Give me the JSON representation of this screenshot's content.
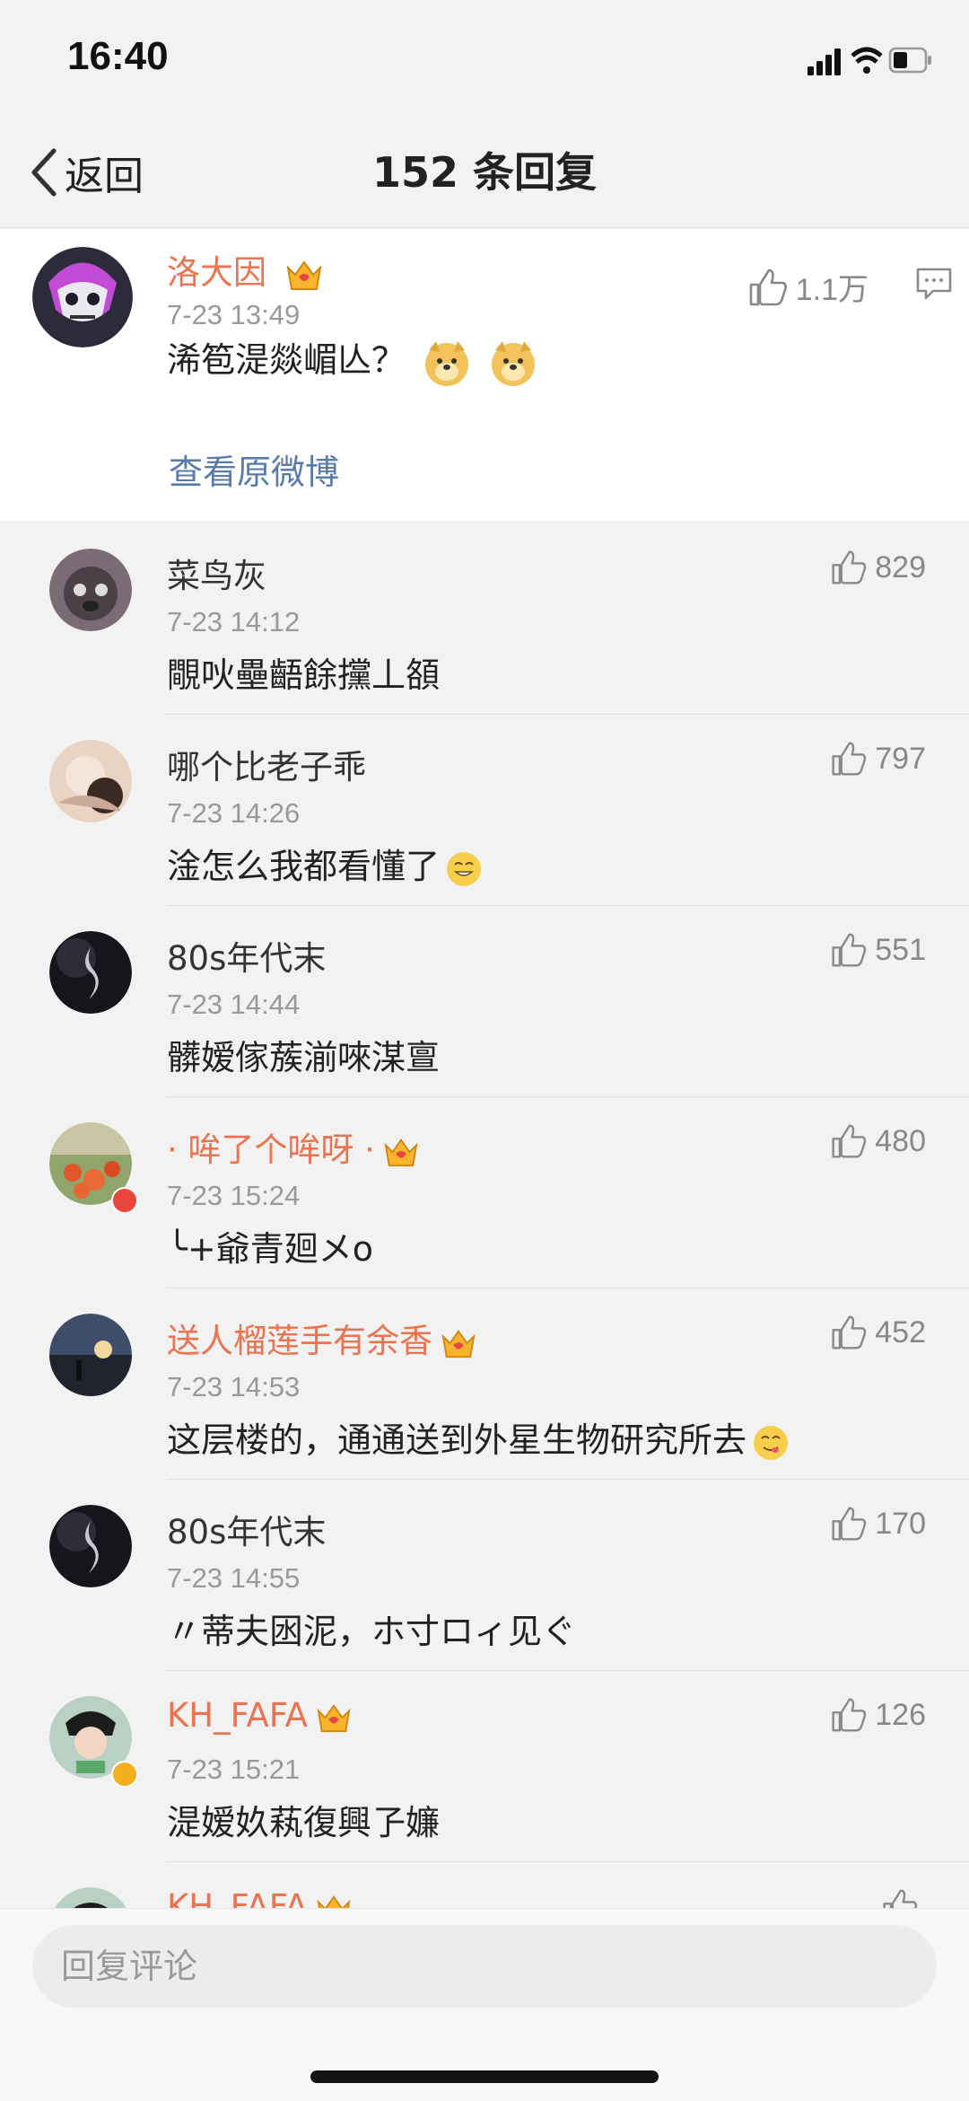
{
  "status_bar": {
    "time": "16:40"
  },
  "nav": {
    "back_label": "返回",
    "title": "152 条回复"
  },
  "main_comment": {
    "username": "洛大因",
    "timestamp": "7-23 13:49",
    "content": "浠笣湜燚嵋亾？",
    "likes": "1.1万",
    "view_original": "查看原微博"
  },
  "replies": [
    {
      "username": "菜鸟灰",
      "timestamp": "7-23 14:12",
      "content": "覸吙壘齬餘攩丄頟",
      "likes": "829"
    },
    {
      "username": "哪个比老子乖",
      "timestamp": "7-23 14:26",
      "content": "淦怎么我都看懂了",
      "likes": "797"
    },
    {
      "username": "80s年代末",
      "timestamp": "7-23 14:44",
      "content": "髒嫒傢蔟湔唻湈亶",
      "likes": "551"
    },
    {
      "username": "· 哞了个哞呀 ·",
      "timestamp": "7-23 15:24",
      "content": "╰+爺青廻メo",
      "likes": "480"
    },
    {
      "username": "送人榴莲手有余香",
      "timestamp": "7-23 14:53",
      "content": "这层楼的，通通送到外星生物研究所去",
      "likes": "452"
    },
    {
      "username": "80s年代末",
      "timestamp": "7-23 14:55",
      "content": "〃蒂夫囦泥，ホ寸ロィ见ぐ",
      "likes": "170"
    },
    {
      "username": "KH_FAFA",
      "timestamp": "7-23 15:21",
      "content": "湜嫒奺萟復興孒嬚",
      "likes": "126"
    },
    {
      "username": "KH_FAFA",
      "timestamp": "",
      "content": "",
      "likes": ""
    }
  ],
  "bottom": {
    "reply_placeholder": "回复评论"
  },
  "colors": {
    "vip_name": "#eb7350",
    "link": "#5a7ba9",
    "background": "#f2f2f2"
  }
}
